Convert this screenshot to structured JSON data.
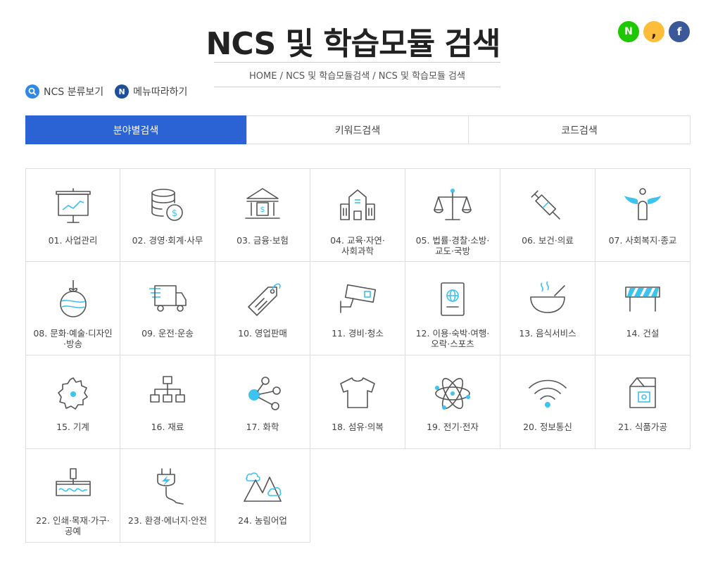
{
  "page": {
    "title": "NCS 및 학습모듈 검색",
    "breadcrumb": "HOME / NCS 및 학습모듈검색 / NCS 및 학습모듈 검색"
  },
  "social": {
    "naver": "N",
    "kakao": ",",
    "facebook": "f"
  },
  "util": {
    "classify": "NCS 분류보기",
    "follow": "메뉴따라하기",
    "follow_icon": "N"
  },
  "tabs": [
    {
      "label": "분야별검색"
    },
    {
      "label": "키워드검색"
    },
    {
      "label": "코드검색"
    }
  ],
  "colors": {
    "accent": "#2c63d4",
    "icon_accent": "#3ec2ef"
  },
  "categories": [
    {
      "label": "01. 사업관리",
      "icon": "presentation-board-icon"
    },
    {
      "label": "02. 경영·회계·사무",
      "icon": "coins-icon"
    },
    {
      "label": "03. 금융·보험",
      "icon": "bank-icon"
    },
    {
      "label": "04. 교육·자연·\n사회과학",
      "icon": "school-building-icon"
    },
    {
      "label": "05. 법률·경찰·소방·\n교도·국방",
      "icon": "scales-icon"
    },
    {
      "label": "06. 보건·의료",
      "icon": "syringe-icon"
    },
    {
      "label": "07. 사회복지·종교",
      "icon": "angel-icon"
    },
    {
      "label": "08. 문화·예술·디자인\n·방송",
      "icon": "ornament-icon"
    },
    {
      "label": "09. 운전·운송",
      "icon": "truck-icon"
    },
    {
      "label": "10. 영업판매",
      "icon": "price-tag-icon"
    },
    {
      "label": "11. 경비·청소",
      "icon": "cctv-camera-icon"
    },
    {
      "label": "12. 이용·숙박·여행·\n오락·스포츠",
      "icon": "passport-icon"
    },
    {
      "label": "13. 음식서비스",
      "icon": "soup-bowl-icon"
    },
    {
      "label": "14. 건설",
      "icon": "road-barrier-icon"
    },
    {
      "label": "15. 기계",
      "icon": "gear-icon"
    },
    {
      "label": "16. 재료",
      "icon": "hierarchy-icon"
    },
    {
      "label": "17. 화학",
      "icon": "molecule-icon"
    },
    {
      "label": "18. 섬유·의복",
      "icon": "tshirt-icon"
    },
    {
      "label": "19. 전기·전자",
      "icon": "atom-icon"
    },
    {
      "label": "20. 정보통신",
      "icon": "wifi-icon"
    },
    {
      "label": "21. 식품가공",
      "icon": "milk-carton-icon"
    },
    {
      "label": "22. 인쇄·목재·가구·\n공예",
      "icon": "paint-roller-icon"
    },
    {
      "label": "23. 환경·에너지·안전",
      "icon": "power-plug-icon"
    },
    {
      "label": "24. 농림어업",
      "icon": "mountains-icon"
    }
  ]
}
